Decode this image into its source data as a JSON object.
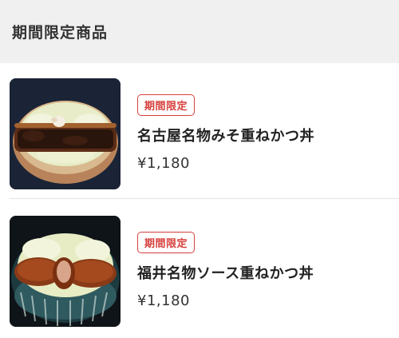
{
  "header": {
    "title": "期間限定商品"
  },
  "products": [
    {
      "badge": "期間限定",
      "name": "名古屋名物みそ重ねかつ丼",
      "price": "¥1,180",
      "image_icon": "miso-katsudon-photo"
    },
    {
      "badge": "期間限定",
      "name": "福井名物ソース重ねかつ丼",
      "price": "¥1,180",
      "image_icon": "sauce-katsudon-photo"
    }
  ],
  "colors": {
    "accent_red": "#d6403b",
    "header_bg": "#f0f0f0"
  }
}
